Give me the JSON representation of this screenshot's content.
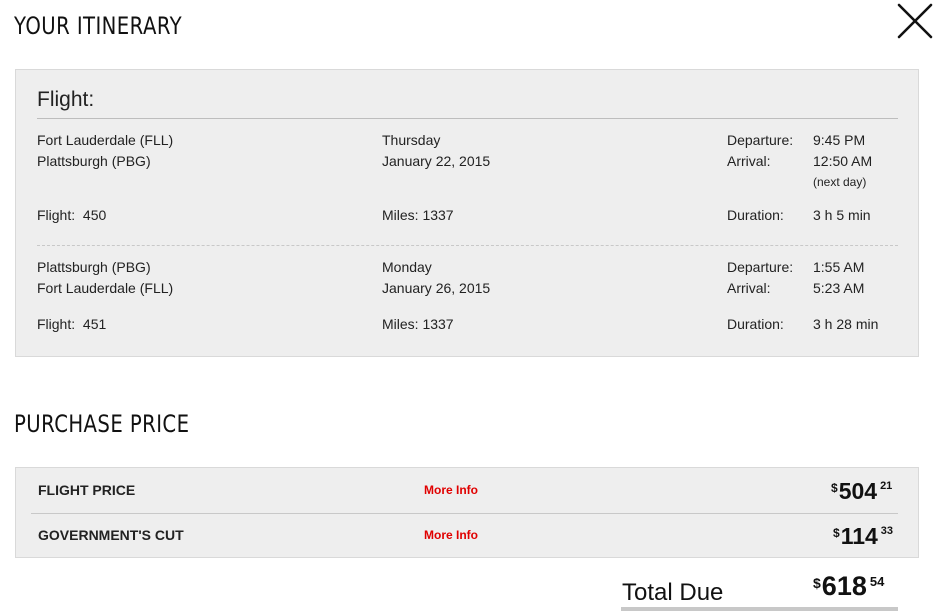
{
  "itinerary": {
    "heading": "YOUR ITINERARY",
    "flight_label": "Flight:",
    "legs": [
      {
        "origin": "Fort Lauderdale (FLL)",
        "destination": "Plattsburgh (PBG)",
        "day": "Thursday",
        "date": "January 22, 2015",
        "departure_label": "Departure:",
        "departure_time": "9:45 PM",
        "arrival_label": "Arrival:",
        "arrival_time": "12:50 AM",
        "arrival_note": "(next day)",
        "flight_label": "Flight:",
        "flight_number": "450",
        "miles_label": "Miles:",
        "miles": "1337",
        "duration_label": "Duration:",
        "duration": "3 h 5 min"
      },
      {
        "origin": "Plattsburgh (PBG)",
        "destination": "Fort Lauderdale (FLL)",
        "day": "Monday",
        "date": "January 26, 2015",
        "departure_label": "Departure:",
        "departure_time": "1:55 AM",
        "arrival_label": "Arrival:",
        "arrival_time": "5:23 AM",
        "arrival_note": "",
        "flight_label": "Flight:",
        "flight_number": "451",
        "miles_label": "Miles:",
        "miles": "1337",
        "duration_label": "Duration:",
        "duration": "3 h 28 min"
      }
    ]
  },
  "purchase": {
    "heading": "PURCHASE PRICE",
    "rows": [
      {
        "label": "FLIGHT PRICE",
        "link": "More Info",
        "currency": "$",
        "dollars": "504",
        "cents": "21"
      },
      {
        "label": "GOVERNMENT'S CUT",
        "link": "More Info",
        "currency": "$",
        "dollars": "114",
        "cents": "33"
      }
    ],
    "total": {
      "label": "Total Due",
      "currency": "$",
      "dollars": "618",
      "cents": "54"
    }
  },
  "icons": {
    "close": "close-icon"
  },
  "colors": {
    "panel_bg": "#eeeeee",
    "link_red": "#e00000",
    "text": "#222222"
  }
}
